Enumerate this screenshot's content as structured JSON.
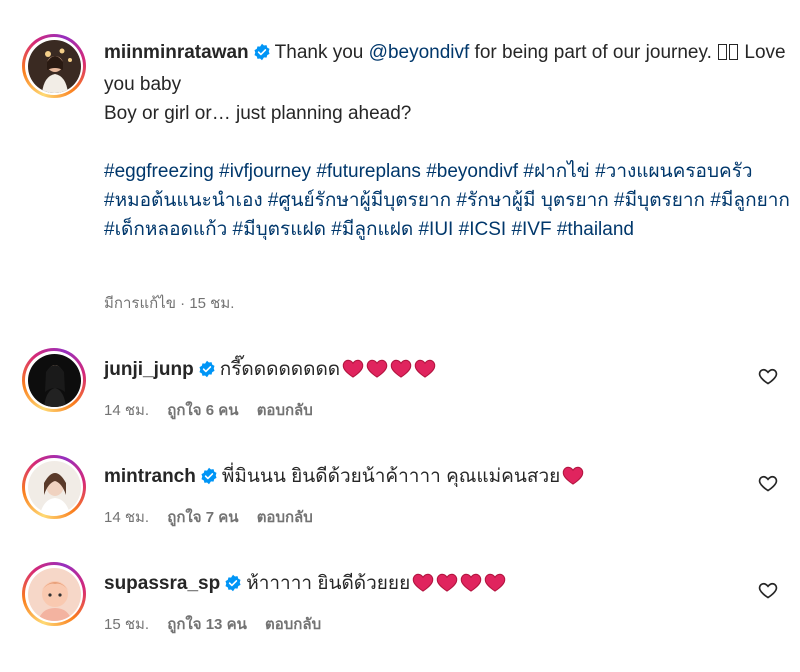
{
  "post": {
    "username": "miinminratawan",
    "verified": true,
    "caption": {
      "intro": "Thank you ",
      "mention": "@beyondivf",
      "after_mention": " for being part of our journey. ",
      "love": " Love you baby",
      "line2": "Boy or girl or… just planning ahead?"
    },
    "hashtags": [
      "#eggfreezing",
      "#ivfjourney",
      "#futureplans",
      "#beyondivf",
      "#ฝากไข่",
      "#วางแผนครอบครัว",
      "#หมอต้นแนะนำเอง",
      "#ศูนย์รักษาผู้มีบุตรยาก",
      "#รักษาผู้มี",
      "บุตรยาก",
      "#มีบุตรยาก",
      "#มีลูกยาก",
      "#เด็กหลอดแก้ว",
      "#มีบุตรแฝด",
      "#มีลูกแฝด",
      "#IUI",
      "#ICSI",
      "#IVF",
      "#thailand"
    ],
    "meta": "มีการแก้ไข · 15 ชม."
  },
  "comments": [
    {
      "username": "junji_junp",
      "text": "กรี๊ดดดดดดดด",
      "hearts": 4,
      "time": "14 ชม.",
      "likes": "ถูกใจ 6 คน",
      "reply": "ตอบกลับ"
    },
    {
      "username": "mintranch",
      "text": "พี่มินนน ยินดีด้วยน้าค้าาาา คุณแม่คนสวย",
      "hearts": 1,
      "time": "14 ชม.",
      "likes": "ถูกใจ 7 คน",
      "reply": "ตอบกลับ"
    },
    {
      "username": "supassra_sp",
      "text": "ห้าาาาา ยินดีด้วยยย",
      "hearts": 4,
      "time": "15 ชม.",
      "likes": "ถูกใจ 13 คน",
      "reply": "ตอบกลับ"
    }
  ],
  "icons": {
    "verified": "verified-badge-icon",
    "like": "heart-outline-icon",
    "emoji": "red-heart-emoji-icon"
  },
  "colors": {
    "verified": "#0095f6",
    "link": "#00376b",
    "muted": "#737373",
    "heart": "#e0245e"
  }
}
